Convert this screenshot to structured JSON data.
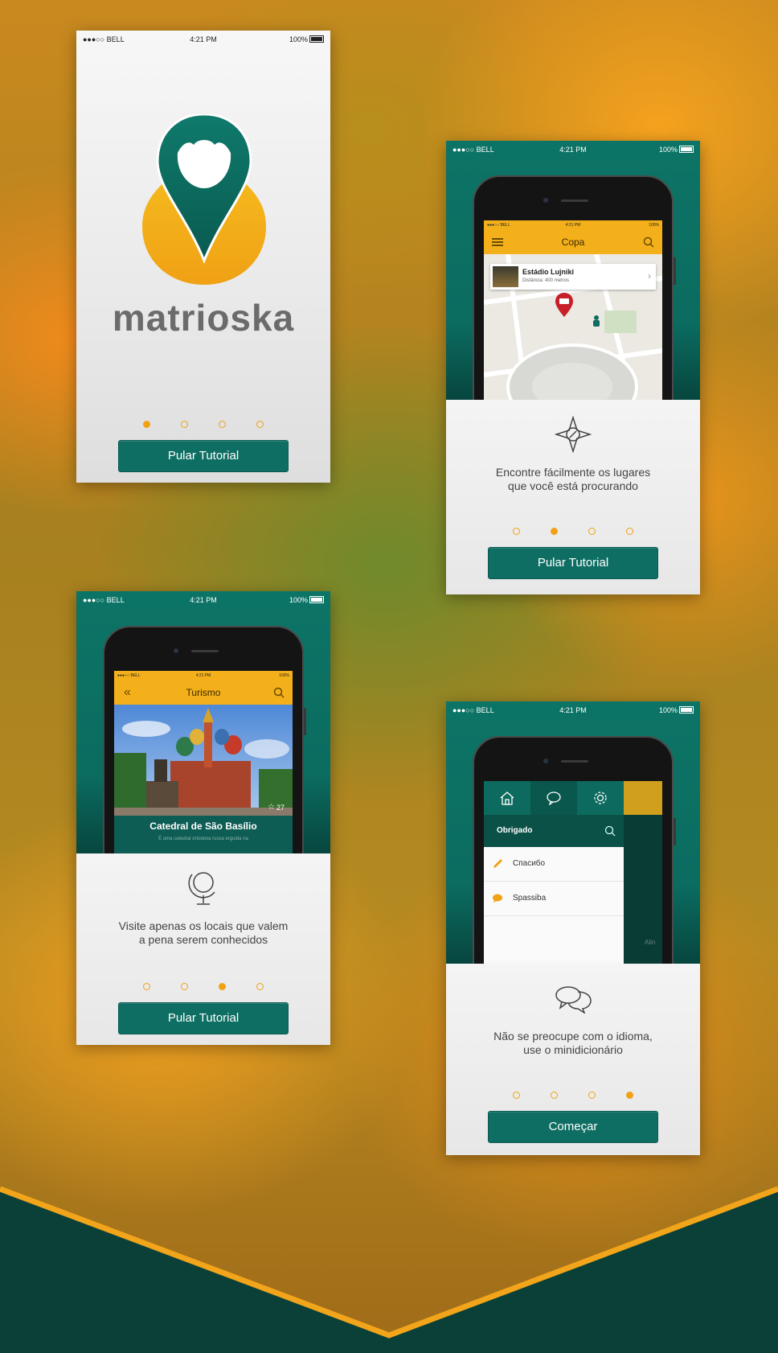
{
  "status": {
    "carrier": "●●●○○ BELL",
    "time": "4:21 PM",
    "battery": "100%"
  },
  "screen1": {
    "brand": "matrioska",
    "button": "Pular Tutorial",
    "active_dot": 0
  },
  "screen2": {
    "inner_status": {
      "carrier": "●●●○○ BELL",
      "time": "4:21 PM",
      "battery": "100%"
    },
    "app_title": "Copa",
    "place_name": "Estádio Lujniki",
    "place_distance": "Distância: 400 metros",
    "caption_line1": "Encontre fácilmente os lugares",
    "caption_line2": "que você está procurando",
    "button": "Pular Tutorial",
    "active_dot": 1
  },
  "screen3": {
    "inner_status": {
      "carrier": "●●●○○ BELL",
      "time": "4:21 PM",
      "battery": "100%"
    },
    "app_title": "Turismo",
    "photo_likes": "27",
    "place_name": "Catedral de São Basílio",
    "place_snippet": "É uma catedral ortodoxa russa erguida na",
    "caption_line1": "Visite apenas os locais que valem",
    "caption_line2": "a pena serem conhecidos",
    "button": "Pular Tutorial",
    "active_dot": 2
  },
  "screen4": {
    "search_title": "Obrigado",
    "items": [
      {
        "label": "Спасибо",
        "icon": "pencil-icon"
      },
      {
        "label": "Spassiba",
        "icon": "speech-bubble-icon"
      }
    ],
    "peek_text": "Alin",
    "caption_line1": "Não se preocupe com o idioma,",
    "caption_line2": "use o minidicionário",
    "button": "Começar",
    "active_dot": 3
  },
  "colors": {
    "teal": "#0f6e63",
    "amber": "#f0a114",
    "logo_gray": "#6b6b6b"
  }
}
